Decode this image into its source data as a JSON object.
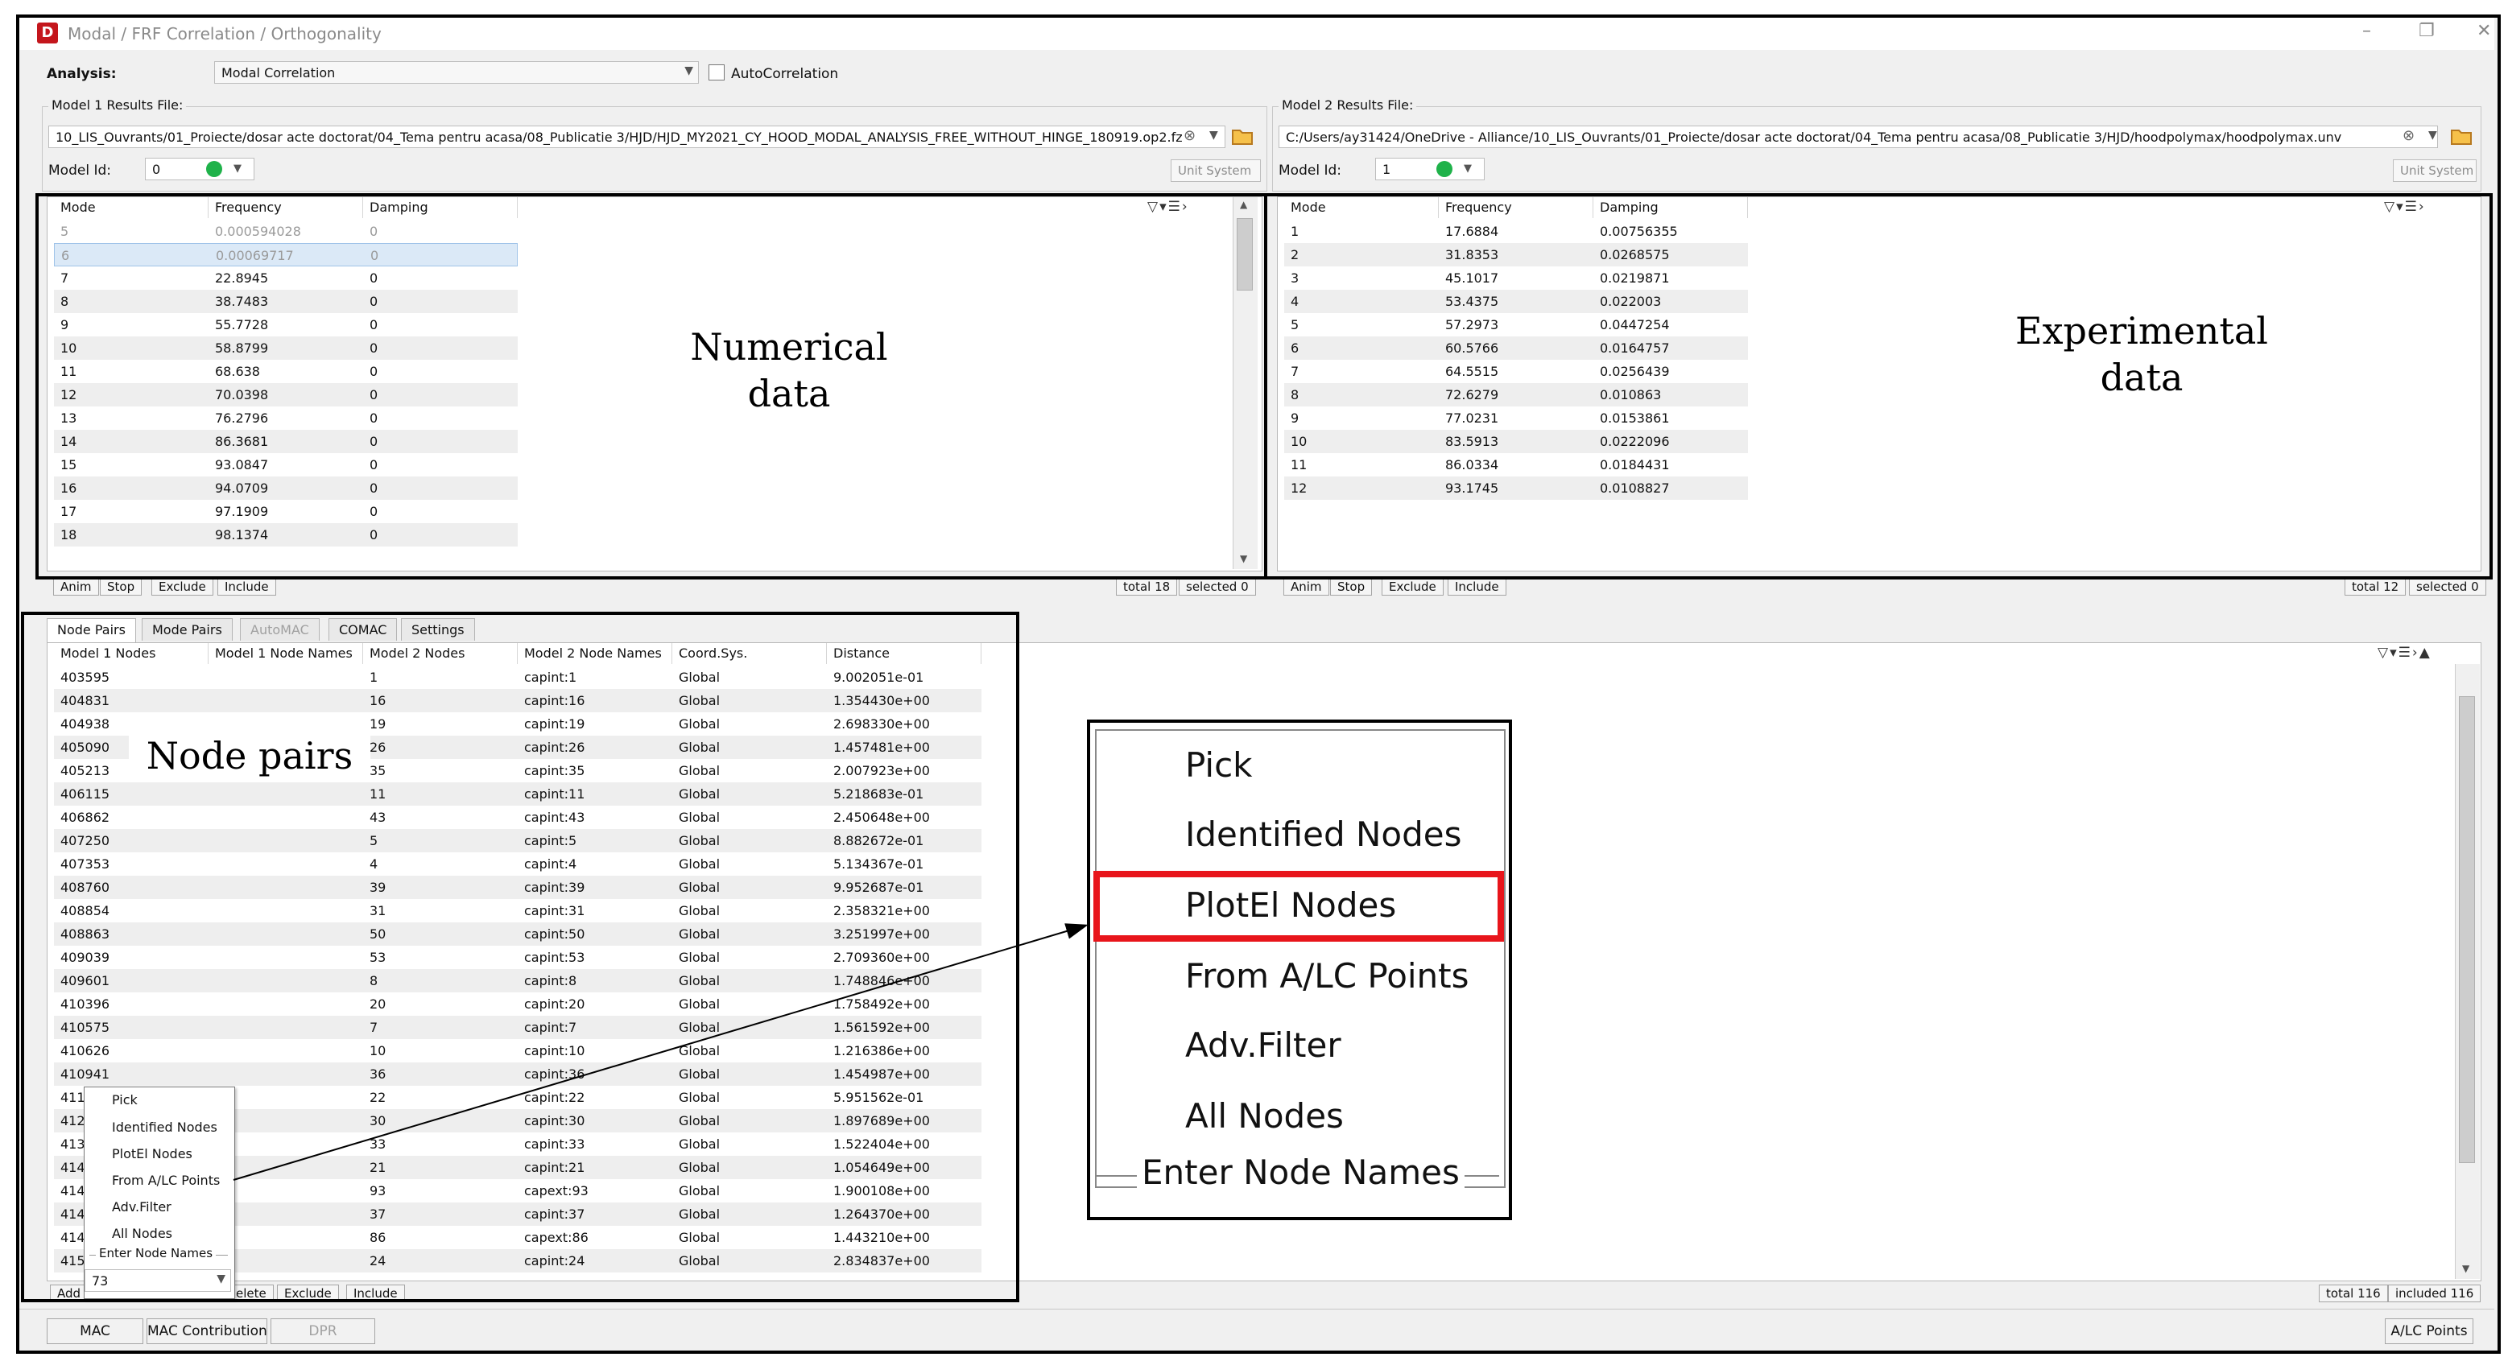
{
  "window": {
    "title": "Modal / FRF Correlation / Orthogonality",
    "app_icon_glyph": "D",
    "minimize_glyph": "–",
    "restore_glyph": "❐",
    "close_glyph": "✕"
  },
  "analysis": {
    "label": "Analysis:",
    "value": "Modal Correlation",
    "autocorrelation_label": "AutoCorrelation"
  },
  "model1": {
    "group_title": "Model 1 Results File:",
    "file_path": "10_LIS_Ouvrants/01_Proiecte/dosar acte doctorat/04_Tema pentru acasa/08_Publicatie 3/HJD/HJD_MY2021_CY_HOOD_MODAL_ANALYSIS_FREE_WITHOUT_HINGE_180919.op2.fz",
    "model_id_label": "Model Id:",
    "model_id_value": "0",
    "unit_system_label": "Unit System",
    "columns": [
      "Mode",
      "Frequency",
      "Damping"
    ],
    "rows": [
      {
        "mode": "5",
        "freq": "0.000594028",
        "damp": "0",
        "dim": true
      },
      {
        "mode": "6",
        "freq": "0.00069717",
        "damp": "0",
        "dim": true
      },
      {
        "mode": "7",
        "freq": "22.8945",
        "damp": "0"
      },
      {
        "mode": "8",
        "freq": "38.7483",
        "damp": "0"
      },
      {
        "mode": "9",
        "freq": "55.7728",
        "damp": "0"
      },
      {
        "mode": "10",
        "freq": "58.8799",
        "damp": "0"
      },
      {
        "mode": "11",
        "freq": "68.638",
        "damp": "0"
      },
      {
        "mode": "12",
        "freq": "70.0398",
        "damp": "0"
      },
      {
        "mode": "13",
        "freq": "76.2796",
        "damp": "0"
      },
      {
        "mode": "14",
        "freq": "86.3681",
        "damp": "0"
      },
      {
        "mode": "15",
        "freq": "93.0847",
        "damp": "0"
      },
      {
        "mode": "16",
        "freq": "94.0709",
        "damp": "0"
      },
      {
        "mode": "17",
        "freq": "97.1909",
        "damp": "0"
      },
      {
        "mode": "18",
        "freq": "98.1374",
        "damp": "0"
      }
    ],
    "buttons": [
      "Anim",
      "Stop",
      "Exclude",
      "Include"
    ],
    "status_total": "total 18",
    "status_selected": "selected 0"
  },
  "model2": {
    "group_title": "Model 2 Results File:",
    "file_path": "C:/Users/ay31424/OneDrive - Alliance/10_LIS_Ouvrants/01_Proiecte/dosar acte doctorat/04_Tema pentru acasa/08_Publicatie 3/HJD/hoodpolymax/hoodpolymax.unv",
    "model_id_label": "Model Id:",
    "model_id_value": "1",
    "unit_system_label": "Unit System",
    "columns": [
      "Mode",
      "Frequency",
      "Damping"
    ],
    "rows": [
      {
        "mode": "1",
        "freq": "17.6884",
        "damp": "0.00756355"
      },
      {
        "mode": "2",
        "freq": "31.8353",
        "damp": "0.0268575"
      },
      {
        "mode": "3",
        "freq": "45.1017",
        "damp": "0.0219871"
      },
      {
        "mode": "4",
        "freq": "53.4375",
        "damp": "0.022003"
      },
      {
        "mode": "5",
        "freq": "57.2973",
        "damp": "0.0447254"
      },
      {
        "mode": "6",
        "freq": "60.5766",
        "damp": "0.0164757"
      },
      {
        "mode": "7",
        "freq": "64.5515",
        "damp": "0.0256439"
      },
      {
        "mode": "8",
        "freq": "72.6279",
        "damp": "0.010863"
      },
      {
        "mode": "9",
        "freq": "77.0231",
        "damp": "0.0153861"
      },
      {
        "mode": "10",
        "freq": "83.5913",
        "damp": "0.0222096"
      },
      {
        "mode": "11",
        "freq": "86.0334",
        "damp": "0.0184431"
      },
      {
        "mode": "12",
        "freq": "93.1745",
        "damp": "0.0108827"
      }
    ],
    "buttons": [
      "Anim",
      "Stop",
      "Exclude",
      "Include"
    ],
    "status_total": "total 12",
    "status_selected": "selected 0"
  },
  "annotations": {
    "numerical_line1": "Numerical",
    "numerical_line2": "data",
    "experimental_line1": "Experimental",
    "experimental_line2": "data",
    "node_pairs": "Node pairs"
  },
  "tabs": [
    {
      "label": "Node Pairs",
      "state": "active"
    },
    {
      "label": "Mode Pairs",
      "state": "normal"
    },
    {
      "label": "AutoMAC",
      "state": "disabled"
    },
    {
      "label": "COMAC",
      "state": "normal"
    },
    {
      "label": "Settings",
      "state": "normal"
    }
  ],
  "node_table": {
    "columns": [
      "Model 1 Nodes",
      "Model 1 Node Names",
      "Model 2 Nodes",
      "Model 2 Node Names",
      "Coord.Sys.",
      "Distance"
    ],
    "rows": [
      [
        "403595",
        "",
        "1",
        "capint:1",
        "Global",
        "9.002051e-01"
      ],
      [
        "404831",
        "",
        "16",
        "capint:16",
        "Global",
        "1.354430e+00"
      ],
      [
        "404938",
        "",
        "19",
        "capint:19",
        "Global",
        "2.698330e+00"
      ],
      [
        "405090",
        "",
        "26",
        "capint:26",
        "Global",
        "1.457481e+00"
      ],
      [
        "405213",
        "",
        "35",
        "capint:35",
        "Global",
        "2.007923e+00"
      ],
      [
        "406115",
        "",
        "11",
        "capint:11",
        "Global",
        "5.218683e-01"
      ],
      [
        "406862",
        "",
        "43",
        "capint:43",
        "Global",
        "2.450648e+00"
      ],
      [
        "407250",
        "",
        "5",
        "capint:5",
        "Global",
        "8.882672e-01"
      ],
      [
        "407353",
        "",
        "4",
        "capint:4",
        "Global",
        "5.134367e-01"
      ],
      [
        "408760",
        "",
        "39",
        "capint:39",
        "Global",
        "9.952687e-01"
      ],
      [
        "408854",
        "",
        "31",
        "capint:31",
        "Global",
        "2.358321e+00"
      ],
      [
        "408863",
        "",
        "50",
        "capint:50",
        "Global",
        "3.251997e+00"
      ],
      [
        "409039",
        "",
        "53",
        "capint:53",
        "Global",
        "2.709360e+00"
      ],
      [
        "409601",
        "",
        "8",
        "capint:8",
        "Global",
        "1.748846e+00"
      ],
      [
        "410396",
        "",
        "20",
        "capint:20",
        "Global",
        "1.758492e+00"
      ],
      [
        "410575",
        "",
        "7",
        "capint:7",
        "Global",
        "1.561592e+00"
      ],
      [
        "410626",
        "",
        "10",
        "capint:10",
        "Global",
        "1.216386e+00"
      ],
      [
        "410941",
        "",
        "36",
        "capint:36",
        "Global",
        "1.454987e+00"
      ],
      [
        "411",
        "",
        "22",
        "capint:22",
        "Global",
        "5.951562e-01"
      ],
      [
        "412",
        "",
        "30",
        "capint:30",
        "Global",
        "1.897689e+00"
      ],
      [
        "413",
        "",
        "33",
        "capint:33",
        "Global",
        "1.522404e+00"
      ],
      [
        "414",
        "",
        "21",
        "capint:21",
        "Global",
        "1.054649e+00"
      ],
      [
        "414",
        "",
        "93",
        "capext:93",
        "Global",
        "1.900108e+00"
      ],
      [
        "414",
        "",
        "37",
        "capint:37",
        "Global",
        "1.264370e+00"
      ],
      [
        "414",
        "",
        "86",
        "capext:86",
        "Global",
        "1.443210e+00"
      ],
      [
        "415",
        "",
        "24",
        "capint:24",
        "Global",
        "2.834837e+00"
      ]
    ],
    "buttons": [
      "Add",
      "elete",
      "Exclude",
      "Include"
    ],
    "status_total": "total 116",
    "status_included": "included 116"
  },
  "context_menu": {
    "items": [
      "Pick",
      "Identified Nodes",
      "PlotEl Nodes",
      "From A/LC Points",
      "Adv.Filter",
      "All Nodes"
    ],
    "group_label": "Enter Node Names",
    "input_value": "73",
    "highlight_item": "PlotEl Nodes",
    "highlight_color": "#e8151b"
  },
  "bottom_bar": {
    "mac": "MAC",
    "mac_contribution": "MAC Contribution",
    "dpr": "DPR",
    "alc_points": "A/LC Points"
  },
  "icons": {
    "filter": "filter-icon",
    "column_menu": "column-menu-icon",
    "expand": "expand-icon",
    "folder": "folder-icon",
    "clear": "clear-icon"
  }
}
